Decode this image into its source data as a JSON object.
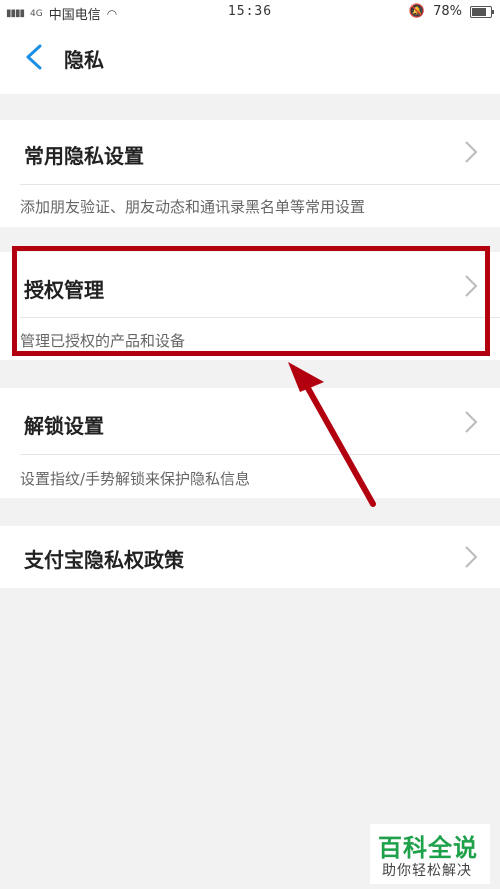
{
  "status_bar": {
    "carrier": "中国电信",
    "signal_text": "4G",
    "time": "15:36",
    "battery": "78%",
    "battery_level": 0.78
  },
  "header": {
    "back_icon": "chevron-left-icon",
    "title": "隐私"
  },
  "sections": [
    {
      "title": "常用隐私设置",
      "description": "添加朋友验证、朋友动态和通讯录黑名单等常用设置"
    },
    {
      "title": "授权管理",
      "description": "管理已授权的产品和设备"
    },
    {
      "title": "解锁设置",
      "description": "设置指纹/手势解锁来保护隐私信息"
    },
    {
      "title": "支付宝隐私权政策",
      "description": ""
    }
  ],
  "annotation": {
    "highlight_color": "#b3000f"
  },
  "watermark": {
    "title": "百科全说",
    "subtitle": "助你轻松解决"
  },
  "colors": {
    "accent": "#1a8fe3",
    "background": "#f2f2f2",
    "watermark_green": "#1ea14a"
  }
}
